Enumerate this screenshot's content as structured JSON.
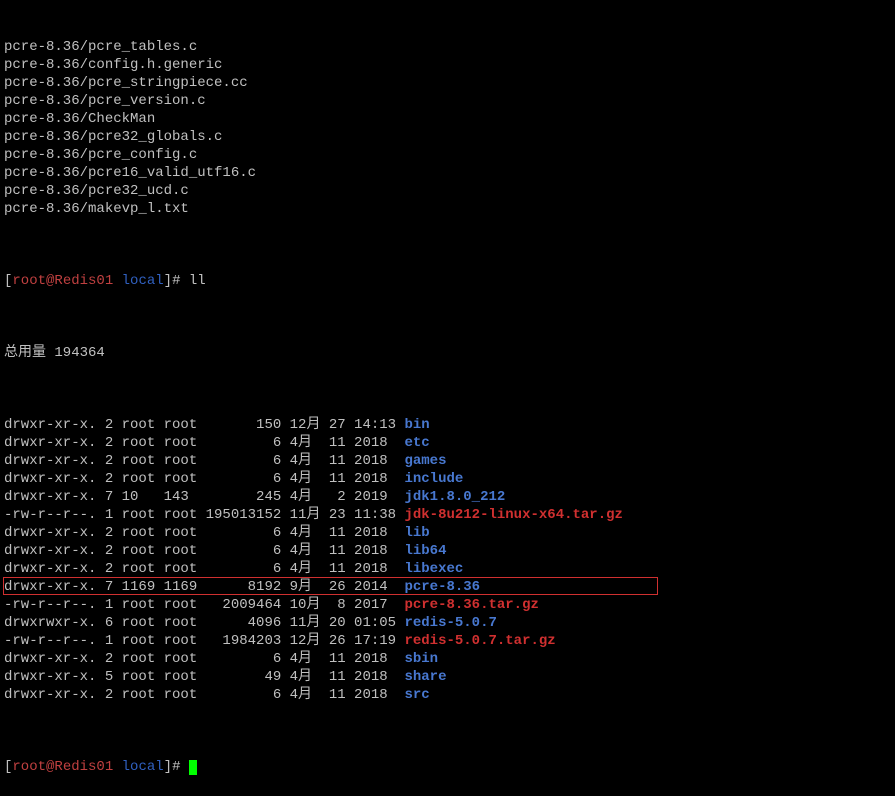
{
  "extracted_files": [
    "pcre-8.36/pcre_tables.c",
    "pcre-8.36/config.h.generic",
    "pcre-8.36/pcre_stringpiece.cc",
    "pcre-8.36/pcre_version.c",
    "pcre-8.36/CheckMan",
    "pcre-8.36/pcre32_globals.c",
    "pcre-8.36/pcre_config.c",
    "pcre-8.36/pcre16_valid_utf16.c",
    "pcre-8.36/pcre32_ucd.c",
    "pcre-8.36/makevp_l.txt"
  ],
  "prompt1": {
    "user": "root",
    "host": "Redis01",
    "path": "local",
    "sym": "#",
    "cmd": "ll"
  },
  "total_line": "总用量 194364",
  "listing": [
    {
      "perm": "drwxr-xr-x.",
      "links": "2",
      "owner": "root",
      "group": "root",
      "size": "150",
      "month": "12月",
      "day": "27",
      "time": "14:13",
      "name": "bin",
      "cls": "dir-name",
      "boxed": false
    },
    {
      "perm": "drwxr-xr-x.",
      "links": "2",
      "owner": "root",
      "group": "root",
      "size": "6",
      "month": "4月",
      "day": "11",
      "time": "2018",
      "name": "etc",
      "cls": "dir-name",
      "boxed": false
    },
    {
      "perm": "drwxr-xr-x.",
      "links": "2",
      "owner": "root",
      "group": "root",
      "size": "6",
      "month": "4月",
      "day": "11",
      "time": "2018",
      "name": "games",
      "cls": "dir-name",
      "boxed": false
    },
    {
      "perm": "drwxr-xr-x.",
      "links": "2",
      "owner": "root",
      "group": "root",
      "size": "6",
      "month": "4月",
      "day": "11",
      "time": "2018",
      "name": "include",
      "cls": "dir-name",
      "boxed": false
    },
    {
      "perm": "drwxr-xr-x.",
      "links": "7",
      "owner": "10",
      "group": "143",
      "size": "245",
      "month": "4月",
      "day": "2",
      "time": "2019",
      "name": "jdk1.8.0_212",
      "cls": "dir-name",
      "boxed": false
    },
    {
      "perm": "-rw-r--r--.",
      "links": "1",
      "owner": "root",
      "group": "root",
      "size": "195013152",
      "month": "11月",
      "day": "23",
      "time": "11:38",
      "name": "jdk-8u212-linux-x64.tar.gz",
      "cls": "arc-name",
      "boxed": false
    },
    {
      "perm": "drwxr-xr-x.",
      "links": "2",
      "owner": "root",
      "group": "root",
      "size": "6",
      "month": "4月",
      "day": "11",
      "time": "2018",
      "name": "lib",
      "cls": "dir-name",
      "boxed": false
    },
    {
      "perm": "drwxr-xr-x.",
      "links": "2",
      "owner": "root",
      "group": "root",
      "size": "6",
      "month": "4月",
      "day": "11",
      "time": "2018",
      "name": "lib64",
      "cls": "dir-name",
      "boxed": false
    },
    {
      "perm": "drwxr-xr-x.",
      "links": "2",
      "owner": "root",
      "group": "root",
      "size": "6",
      "month": "4月",
      "day": "11",
      "time": "2018",
      "name": "libexec",
      "cls": "dir-name",
      "boxed": false
    },
    {
      "perm": "drwxr-xr-x.",
      "links": "7",
      "owner": "1169",
      "group": "1169",
      "size": "8192",
      "month": "9月",
      "day": "26",
      "time": "2014",
      "name": "pcre-8.36",
      "cls": "dir-name",
      "boxed": true
    },
    {
      "perm": "-rw-r--r--.",
      "links": "1",
      "owner": "root",
      "group": "root",
      "size": "2009464",
      "month": "10月",
      "day": "8",
      "time": "2017",
      "name": "pcre-8.36.tar.gz",
      "cls": "arc-name",
      "boxed": false
    },
    {
      "perm": "drwxrwxr-x.",
      "links": "6",
      "owner": "root",
      "group": "root",
      "size": "4096",
      "month": "11月",
      "day": "20",
      "time": "01:05",
      "name": "redis-5.0.7",
      "cls": "dir-name",
      "boxed": false
    },
    {
      "perm": "-rw-r--r--.",
      "links": "1",
      "owner": "root",
      "group": "root",
      "size": "1984203",
      "month": "12月",
      "day": "26",
      "time": "17:19",
      "name": "redis-5.0.7.tar.gz",
      "cls": "arc-name",
      "boxed": false
    },
    {
      "perm": "drwxr-xr-x.",
      "links": "2",
      "owner": "root",
      "group": "root",
      "size": "6",
      "month": "4月",
      "day": "11",
      "time": "2018",
      "name": "sbin",
      "cls": "dir-name",
      "boxed": false
    },
    {
      "perm": "drwxr-xr-x.",
      "links": "5",
      "owner": "root",
      "group": "root",
      "size": "49",
      "month": "4月",
      "day": "11",
      "time": "2018",
      "name": "share",
      "cls": "dir-name",
      "boxed": false
    },
    {
      "perm": "drwxr-xr-x.",
      "links": "2",
      "owner": "root",
      "group": "root",
      "size": "6",
      "month": "4月",
      "day": "11",
      "time": "2018",
      "name": "src",
      "cls": "dir-name",
      "boxed": false
    }
  ],
  "prompt2": {
    "user": "root",
    "host": "Redis01",
    "path": "local",
    "sym": "#",
    "cmd": ""
  }
}
